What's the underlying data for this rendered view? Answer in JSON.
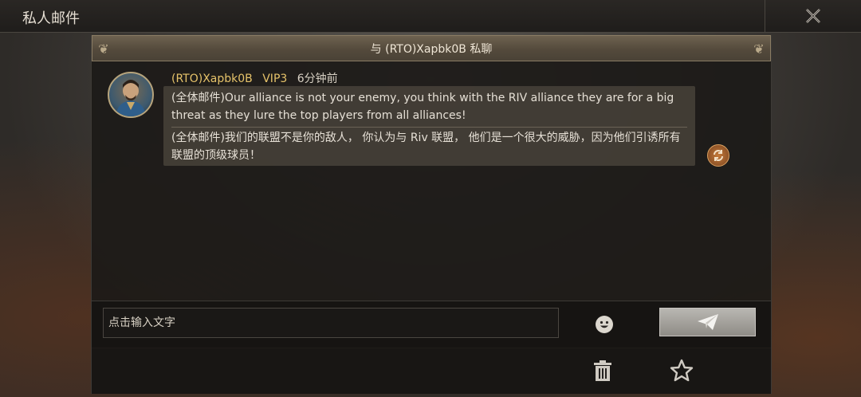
{
  "window": {
    "title": "私人邮件"
  },
  "chat": {
    "header_title": "与 (RTO)Xapbk0B 私聊",
    "message": {
      "sender": "(RTO)Xapbk0B",
      "vip": "VIP3",
      "time": "6分钟前",
      "text_original": "(全体邮件)Our alliance is not your enemy, you think with the RIV alliance they are for a big threat as they lure the top players from all alliances!",
      "text_translated": "(全体邮件)我们的联盟不是你的敌人， 你认为与 Riv 联盟， 他们是一个很大的威胁，因为他们引诱所有联盟的顶级球员！"
    }
  },
  "composer": {
    "placeholder": "点击输入文字"
  },
  "icons": {
    "close": "close-icon",
    "emoji": "emoji-icon",
    "send": "paper-plane-icon",
    "translate": "translate-icon",
    "trash": "trash-icon",
    "star": "star-icon"
  },
  "colors": {
    "vip_name": "#e6c36a",
    "header_bar": "#6e6250"
  }
}
